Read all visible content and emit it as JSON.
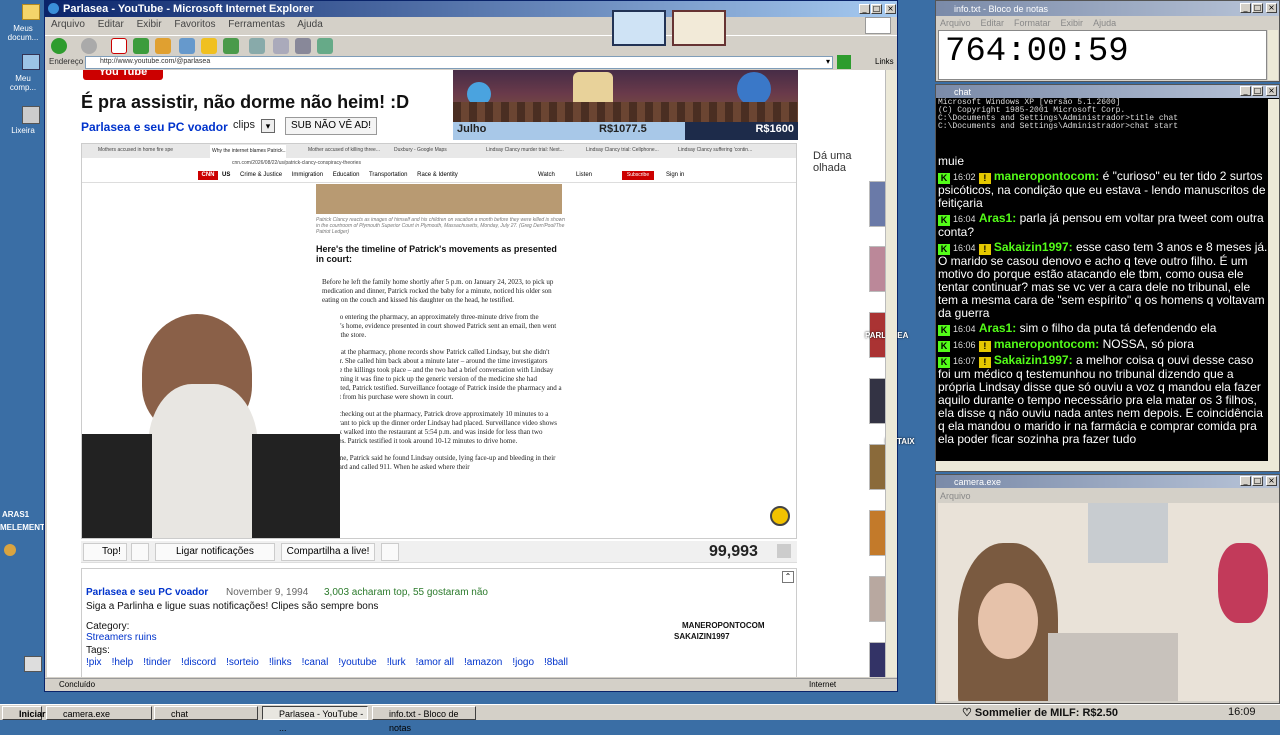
{
  "desktop": {
    "icons": [
      "Meus docum...",
      "Meu comp...",
      "Lixeira"
    ],
    "rasi": "ARAS1",
    "elem": "MELEMENTS"
  },
  "ie": {
    "title": "Parlasea - YouTube - Microsoft Internet Explorer",
    "menu": [
      "Arquivo",
      "Editar",
      "Exibir",
      "Favoritos",
      "Ferramentas",
      "Ajuda"
    ],
    "address_label": "Endereço",
    "url": "http://www.youtube.com/@parlasea",
    "links": "Links",
    "status": "Concluído",
    "zone": "Internet"
  },
  "yt": {
    "logo": "You Tube",
    "title": "É pra assistir, não dorme não heim! :D",
    "channel": "Parlasea e seu PC voador",
    "clips": "clips",
    "sub": "SUB NÃO VÊ AD!",
    "side_heading": "Dá uma olhada",
    "like": "Top!",
    "notify": "Ligar notificações",
    "share": "Compartilha a live!",
    "views": "99,993",
    "info_channel": "Parlasea e seu PC voador",
    "date": "November 9, 1994",
    "likes": "3,003 acharam top, 55 gostaram não",
    "desc": "Siga a Parlinha e ligue suas notificações! Clipes são sempre bons",
    "category_label": "Category:",
    "category": "Streamers ruins",
    "tags_label": "Tags:",
    "tags": [
      "!pix",
      "!help",
      "!tinder",
      "!discord",
      "!sorteio",
      "!links",
      "!canal",
      "!youtube",
      "!lurk",
      "!amor all",
      "!amazon",
      "!jogo",
      "!8ball"
    ],
    "overlay1": "MANEROPONTOCOM",
    "overlay2": "SAKAIZIN1997",
    "side_parlasea": "PARLASEA",
    "side_botaix": "BOTAIX"
  },
  "game": {
    "player": "Julho",
    "money1": "R$1077.5",
    "money2": "R$1600"
  },
  "cnn": {
    "tabs": [
      "Mothers accused in home fire special...",
      "Why the internet blames Patrick...",
      "Mother accused of killing three...",
      "Duxbury - Google Maps",
      "Lindsay Clancy murder trial: Next...",
      "Lindsay Clancy trial: Cellphone...",
      "Lindsay Clancy suffering 'contin..."
    ],
    "url": "cnn.com/2026/08/22/us/patrick-clancy-conspiracy-theories",
    "nav": [
      "US",
      "Crime & Justice",
      "Immigration",
      "Education",
      "Transportation",
      "Race & Identity"
    ],
    "watch": "Watch",
    "listen": "Listen",
    "subscribe": "Subscribe",
    "signin": "Sign in",
    "caption": "Patrick Clancy reacts as images of himself and his children on vacation a month before they were killed is shown in the courtroom of Plymouth Superior Court in Plymouth, Massachusetts, Monday, July 27. (Greg Derr/Pool/The Patriot Ledger)",
    "heading": "Here's the timeline of Patrick's movements as presented in court:",
    "bullets": [
      "Before he left the family home shortly after 5 p.m. on January 24, 2023, to pick up medication and dinner, Patrick rocked the baby for a minute, noticed his older son eating on the couch and kissed his daughter on the head, he testified.",
      "Prior to entering the pharmacy, an approximately three-minute drive from the family's home, evidence presented in court showed Patrick sent an email, then went inside the store.",
      "While at the pharmacy, phone records show Patrick called Lindsay, but she didn't answer. She called him back about a minute later – around the time investigators believe the killings took place – and the two had a brief conversation with Lindsay confirming it was fine to pick up the generic version of the medicine she had requested, Patrick testified. Surveillance footage of Patrick inside the pharmacy and a receipt from his purchase were shown in court.",
      "After checking out at the pharmacy, Patrick drove approximately 10 minutes to a restaurant to pick up the dinner order Lindsay had placed. Surveillance video shows Patrick walked into the restaurant at 5:54 p.m. and was inside for less than two minutes. Patrick testified it took around 10-12 minutes to drive home.",
      "At home, Patrick said he found Lindsay outside, lying face-up and bleeding in their backyard and called 911. When he asked where their"
    ]
  },
  "notepad": {
    "title": "info.txt - Bloco de notas",
    "menu": [
      "Arquivo",
      "Editar",
      "Formatar",
      "Exibir",
      "Ajuda"
    ],
    "text": "764:00:59"
  },
  "cmd": {
    "title": "chat",
    "lines": [
      "Microsoft Windows XP [versão 5.1.2600]",
      "(C) Copyright 1985-2001 Microsoft Corp.",
      "",
      "C:\\Documents and Settings\\Administrador>title chat",
      "",
      "C:\\Documents and Settings\\Administrador>chat start"
    ]
  },
  "chat": [
    {
      "time": "",
      "user": "",
      "text": "muie"
    },
    {
      "time": "16:02",
      "user": "maneropontocom:",
      "text": "é \"curioso\" eu ter tido 2 surtos psicóticos, na condição que eu estava - lendo manuscritos de feitiçaria"
    },
    {
      "time": "16:04",
      "user": "Aras1:",
      "text": "parla já pensou em voltar pra tweet com outra conta?"
    },
    {
      "time": "16:04",
      "user": "Sakaizin1997:",
      "text": "esse caso tem 3 anos e 8 meses já. O marido se casou denovo e acho q teve outro filho. É um motivo do porque estão atacando ele tbm, como ousa ele tentar continuar? mas se vc ver a cara dele no tribunal, ele tem a mesma cara de \"sem espírito\" q os homens q voltavam da guerra"
    },
    {
      "time": "16:04",
      "user": "Aras1:",
      "text": "sim o filho da puta tá defendendo ela"
    },
    {
      "time": "16:06",
      "user": "maneropontocom:",
      "text": "NOSSA, só piora"
    },
    {
      "time": "16:07",
      "user": "Sakaizin1997:",
      "text": "a melhor coisa q ouvi desse caso foi um médico q testemunhou no tribunal dizendo que a própria Lindsay disse que só ouviu a voz q mandou ela fazer aquilo durante o tempo necessário pra ela matar os 3 filhos, ela disse q não ouviu nada antes nem depois. E coincidência q ela mandou o marido ir na farmácia e comprar comida pra ela poder ficar sozinha pra fazer tudo"
    }
  ],
  "camera": {
    "title": "camera.exe",
    "menu": "Arquivo"
  },
  "taskbar": {
    "start": "Iniciar",
    "items": [
      "camera.exe",
      "chat",
      "Parlasea - YouTube - ...",
      "info.txt - Bloco de notas"
    ],
    "ticker": "♡ Sommelier de MILF: R$2.50",
    "clock": "16:09"
  },
  "colors": {
    "desktop": "#3a6ea5",
    "xp_blue": "#0a246a",
    "kick_green": "#53fc18",
    "chat_bg": "#000000"
  }
}
